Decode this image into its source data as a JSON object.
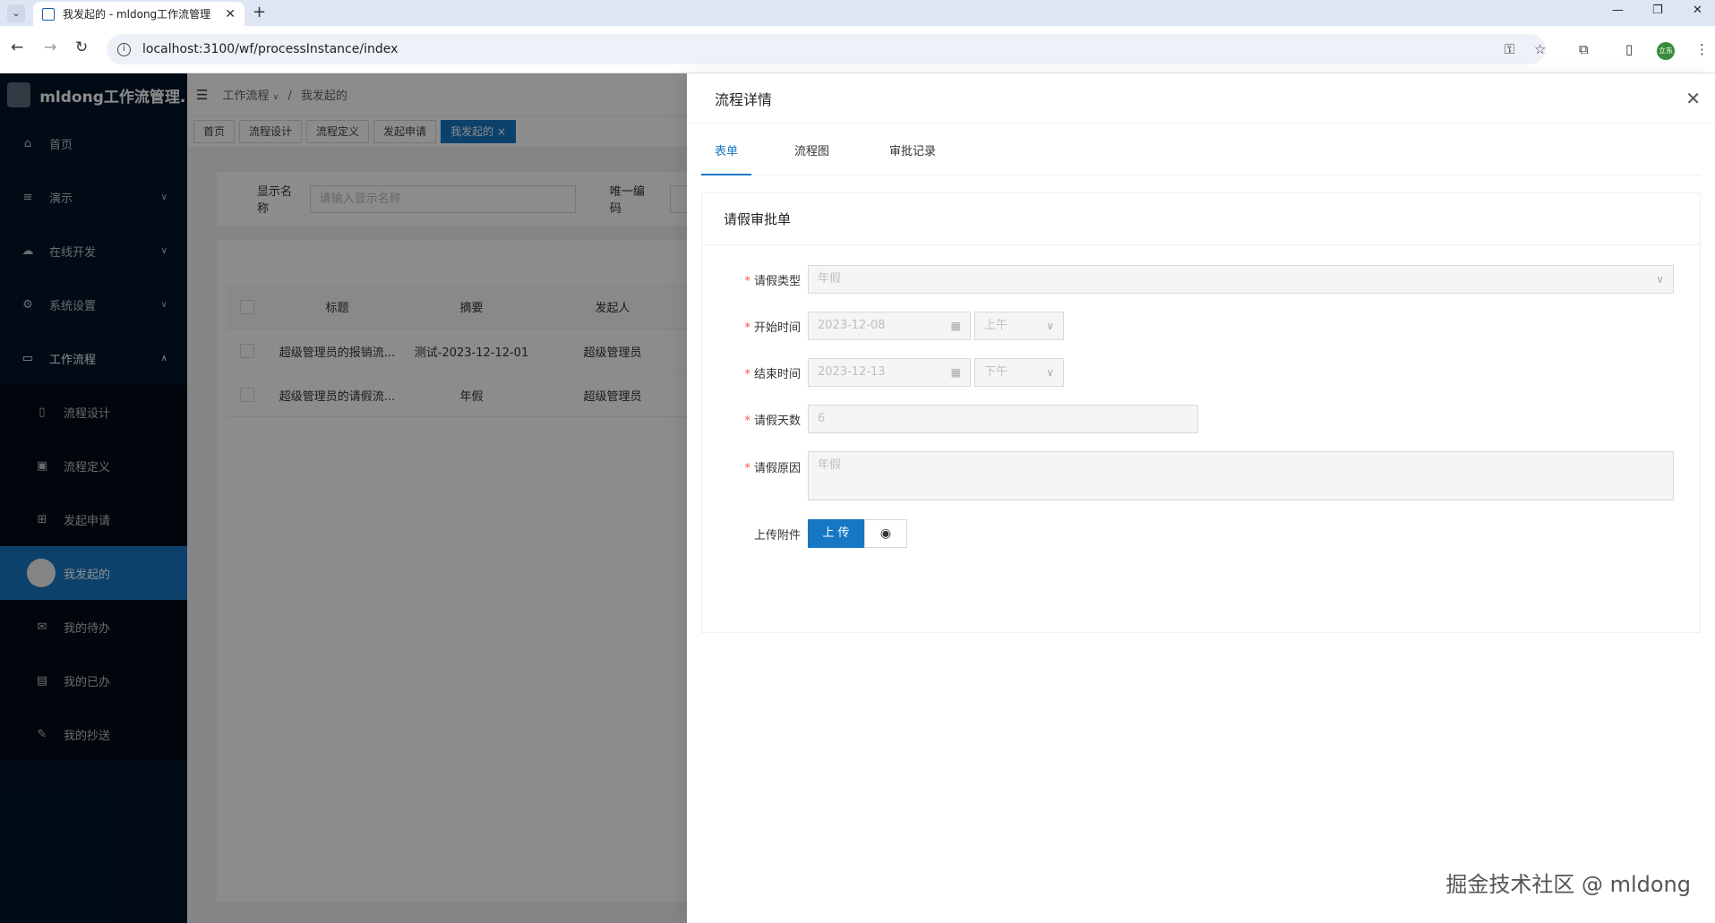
{
  "browser": {
    "tab_title": "我发起的 - mldong工作流管理",
    "url": "localhost:3100/wf/processInstance/index",
    "ext_avatar_label": "立东"
  },
  "sidebar": {
    "title": "mldong工作流管理...",
    "items": [
      {
        "label": "首页",
        "icon": "home-icon"
      },
      {
        "label": "演示",
        "icon": "list-icon"
      },
      {
        "label": "在线开发",
        "icon": "cloud-icon"
      },
      {
        "label": "系统设置",
        "icon": "gear-icon"
      },
      {
        "label": "工作流程",
        "icon": "monitor-icon"
      }
    ],
    "subitems": [
      {
        "label": "流程设计",
        "icon": "doc-icon"
      },
      {
        "label": "流程定义",
        "icon": "image-icon"
      },
      {
        "label": "发起申请",
        "icon": "grid-icon"
      },
      {
        "label": "我发起的",
        "icon": "avatar"
      },
      {
        "label": "我的待办",
        "icon": "mail-icon"
      },
      {
        "label": "我的已办",
        "icon": "card-icon"
      },
      {
        "label": "我的抄送",
        "icon": "edit-icon"
      }
    ]
  },
  "header": {
    "breadcrumb_root": "工作流程",
    "breadcrumb_sep": "/",
    "breadcrumb_current": "我发起的"
  },
  "tags": [
    "首页",
    "流程设计",
    "流程定义",
    "发起申请",
    "我发起的"
  ],
  "search": {
    "name_label": "显示名称",
    "name_placeholder": "请输入显示名称",
    "code_label": "唯一编码"
  },
  "table": {
    "columns": [
      "标题",
      "摘要",
      "发起人"
    ],
    "rows": [
      [
        "超级管理员的报销流...",
        "测试-2023-12-12-01",
        "超级管理员"
      ],
      [
        "超级管理员的请假流...",
        "年假",
        "超级管理员"
      ]
    ]
  },
  "drawer": {
    "title": "流程详情",
    "tabs": [
      "表单",
      "流程图",
      "审批记录"
    ],
    "card_title": "请假审批单",
    "form": {
      "type_label": "请假类型",
      "type_value": "年假",
      "start_label": "开始时间",
      "start_date": "2023-12-08",
      "start_period": "上午",
      "end_label": "结束时间",
      "end_date": "2023-12-13",
      "end_period": "下午",
      "days_label": "请假天数",
      "days_value": "6",
      "reason_label": "请假原因",
      "reason_value": "年假",
      "attach_label": "上传附件",
      "upload_label": "上 传"
    }
  },
  "watermark": "掘金技术社区 @ mldong",
  "colors": {
    "primary": "#1677c5",
    "sidebar": "#001529",
    "required": "#ff4d4f"
  }
}
